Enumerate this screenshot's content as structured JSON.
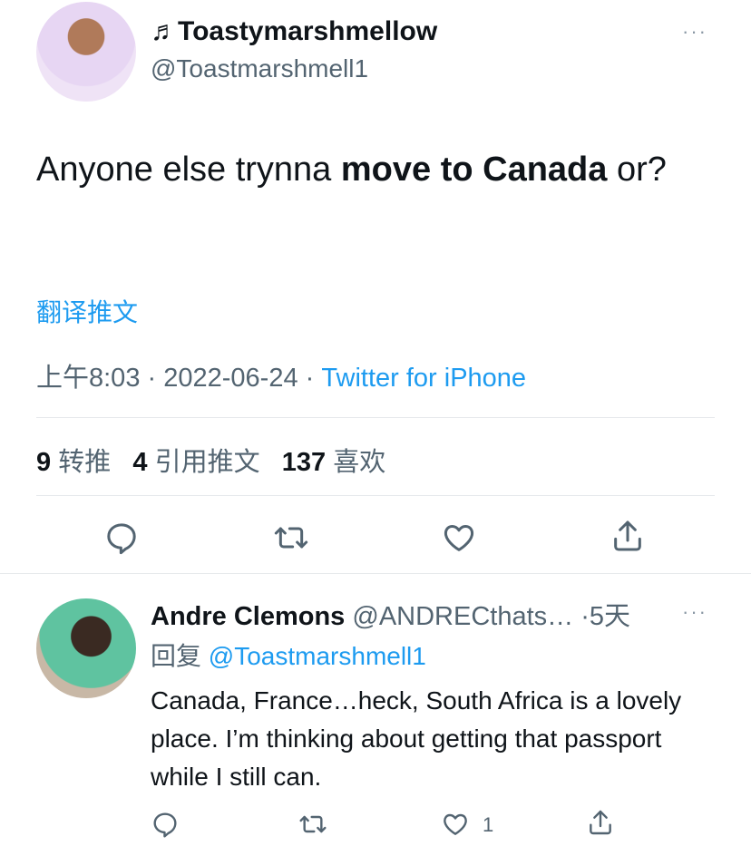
{
  "tweet": {
    "author": {
      "display_name": "♬Toastymarshmellow",
      "handle": "@Toastmarshmell1"
    },
    "more_label": "···",
    "text_before": "Anyone else trynna ",
    "text_bold": "move to Canada",
    "text_after": " or?",
    "translate_label": "翻译推文",
    "time": "上午8:03",
    "sep1": "·",
    "date": "2022-06-24",
    "sep2": "·",
    "source": "Twitter for iPhone",
    "stats": {
      "retweets_count": "9",
      "retweets_label": "转推",
      "quotes_count": "4",
      "quotes_label": "引用推文",
      "likes_count": "137",
      "likes_label": "喜欢"
    },
    "actions": {
      "reply_icon": "reply-icon",
      "retweet_icon": "retweet-icon",
      "like_icon": "heart-icon",
      "share_icon": "share-icon"
    }
  },
  "reply": {
    "display_name": "Andre Clemons",
    "handle": "@ANDRECthats…",
    "sep": "·",
    "age": "5天",
    "more_label": "···",
    "replying_prefix": "回复",
    "replying_to": "@Toastmarshmell1",
    "text": "Canada, France…heck, South Africa is a lovely place. I’m thinking about getting that passport while I still can.",
    "like_count": "1"
  },
  "colors": {
    "accent": "#1d9bf0",
    "text": "#0f1419",
    "muted": "#536471",
    "icon": "#536471",
    "divider": "#e6e9ec"
  }
}
